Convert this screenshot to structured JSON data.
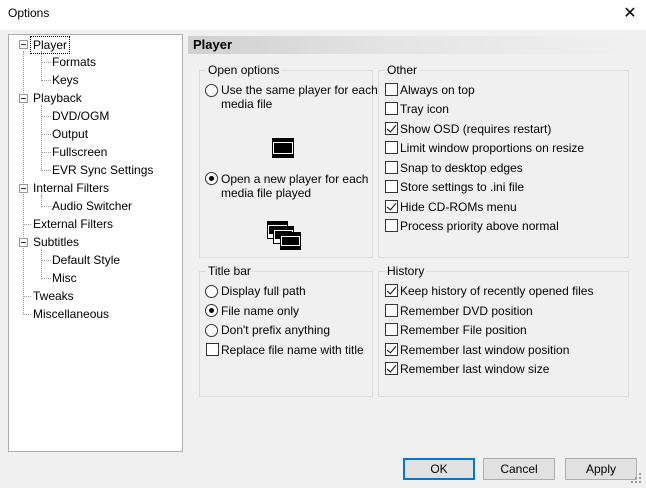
{
  "window": {
    "title": "Options",
    "close_glyph": "✕"
  },
  "tree": {
    "items": [
      {
        "label": "Player",
        "expandable": true,
        "selected": true
      },
      {
        "label": "Formats"
      },
      {
        "label": "Keys"
      },
      {
        "label": "Playback",
        "expandable": true
      },
      {
        "label": "DVD/OGM"
      },
      {
        "label": "Output"
      },
      {
        "label": "Fullscreen"
      },
      {
        "label": "EVR Sync Settings"
      },
      {
        "label": "Internal Filters",
        "expandable": true
      },
      {
        "label": "Audio Switcher"
      },
      {
        "label": "External Filters"
      },
      {
        "label": "Subtitles",
        "expandable": true
      },
      {
        "label": "Default Style"
      },
      {
        "label": "Misc"
      },
      {
        "label": "Tweaks"
      },
      {
        "label": "Miscellaneous"
      }
    ]
  },
  "page": {
    "title": "Player"
  },
  "open_options": {
    "label": "Open options",
    "same_player": {
      "label_line1": "Use the same player for each",
      "label_line2": "media file",
      "checked": false,
      "icon": "single-window-icon"
    },
    "new_player": {
      "label_line1": "Open a new player for each",
      "label_line2": "media file played",
      "checked": true,
      "icon": "multiple-windows-icon"
    }
  },
  "other": {
    "label": "Other",
    "items": [
      {
        "label": "Always on top",
        "checked": false
      },
      {
        "label": "Tray icon",
        "checked": false
      },
      {
        "label": "Show OSD (requires restart)",
        "checked": true
      },
      {
        "label": "Limit window proportions on resize",
        "checked": false
      },
      {
        "label": "Snap to desktop edges",
        "checked": false
      },
      {
        "label": "Store settings to .ini file",
        "checked": false
      },
      {
        "label": "Hide CD-ROMs menu",
        "checked": true
      },
      {
        "label": "Process priority above normal",
        "checked": false
      }
    ]
  },
  "title_bar": {
    "label": "Title bar",
    "radios": [
      {
        "label": "Display full path",
        "checked": false
      },
      {
        "label": "File name only",
        "checked": true
      },
      {
        "label": "Don't prefix anything",
        "checked": false
      }
    ],
    "replace": {
      "label": "Replace file name with title",
      "checked": false
    }
  },
  "history": {
    "label": "History",
    "items": [
      {
        "label": "Keep history of recently opened files",
        "checked": true
      },
      {
        "label": "Remember DVD position",
        "checked": false
      },
      {
        "label": "Remember File position",
        "checked": false
      },
      {
        "label": "Remember last window position",
        "checked": true
      },
      {
        "label": "Remember last window size",
        "checked": true
      }
    ]
  },
  "buttons": {
    "ok": "OK",
    "cancel": "Cancel",
    "apply": "Apply"
  }
}
